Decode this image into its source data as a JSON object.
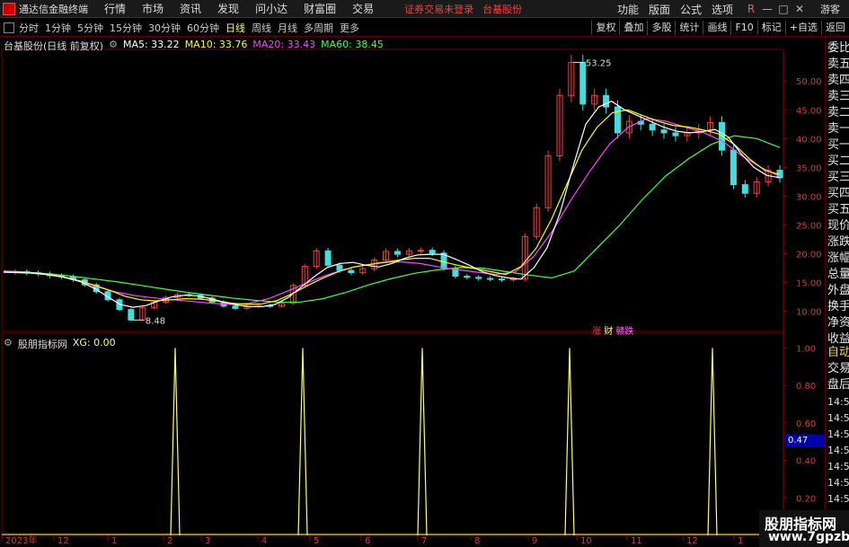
{
  "app": {
    "title": "通达信金融终端",
    "menus": [
      "行情",
      "市场",
      "资讯",
      "发现",
      "问小达",
      "财富圈",
      "交易"
    ],
    "warning": "证券交易未登录",
    "stock_name_top": "台基股份",
    "right_menus": [
      "功能",
      "版面",
      "公式",
      "选项"
    ],
    "guest": "游客",
    "window_buttons": [
      "R",
      "—",
      "□",
      "✕"
    ]
  },
  "toolbar": {
    "periods": [
      "分时",
      "1分钟",
      "5分钟",
      "15分钟",
      "30分钟",
      "60分钟",
      "日线",
      "周线",
      "月线",
      "多周期",
      "更多"
    ],
    "active_period": "日线",
    "buttons": [
      "复权",
      "叠加",
      "多股",
      "统计",
      "画线",
      "F10",
      "标记",
      "+自选",
      "返回"
    ]
  },
  "main_chart": {
    "legend_title": "台基股份(日线 前复权)",
    "ma": [
      {
        "label": "MA5: 33.22",
        "color": "#ffffff"
      },
      {
        "label": "MA10: 33.76",
        "color": "#ffff00"
      },
      {
        "label": "MA20: 33.43",
        "color": "#ff44ff"
      },
      {
        "label": "MA60: 38.45",
        "color": "#44ff44"
      }
    ],
    "annotations": {
      "high": "53.25",
      "low": "8.48"
    },
    "badges": {
      "zhang": "涨",
      "cai": "财",
      "dian": "赣跌"
    }
  },
  "sub_chart": {
    "legend_title": "股朋指标网",
    "xg_label": "XG: 0.00",
    "xg_axis_value": "0.47"
  },
  "side_panel": {
    "items_top": [
      "委比",
      "卖五",
      "卖四",
      "卖三",
      "卖二",
      "卖一",
      "买一",
      "买二",
      "买三",
      "买四",
      "买五",
      "现价",
      "涨跌",
      "涨幅",
      "总量",
      "外盘",
      "换手",
      "净资",
      "收益"
    ],
    "items_bottom": [
      "自动",
      "交易",
      "盘后"
    ],
    "times": [
      "14:56",
      "14:56",
      "14:56",
      "14:56",
      "14:56",
      "14:56",
      "14:56"
    ]
  },
  "watermark": {
    "line1": "股朋指标网",
    "line2": "www.7gpzb.com"
  },
  "chart_data": [
    {
      "type": "line",
      "name": "daily-candles",
      "y_axis_labels": [
        "50.00",
        "45.00",
        "40.00",
        "35.00",
        "30.00",
        "25.00",
        "20.00",
        "15.00",
        "10.00"
      ],
      "ylim": [
        6.5,
        55.5
      ],
      "x_labels": [
        "2023年",
        "12",
        "1",
        "2",
        "3",
        "4",
        "5",
        "6",
        "7",
        "8",
        "9",
        "10",
        "11",
        "12",
        "1"
      ],
      "price_path": [
        16.8,
        16.9,
        16.7,
        16.5,
        16.2,
        16.0,
        15.5,
        14.6,
        13.4,
        12.0,
        10.3,
        8.48,
        10.6,
        11.6,
        12.4,
        12.9,
        12.8,
        12.3,
        11.6,
        10.9,
        10.5,
        10.8,
        11.0,
        10.9,
        11.4,
        14.5,
        17.8,
        20.5,
        18.0,
        17.1,
        16.7,
        17.4,
        18.9,
        20.4,
        19.9,
        20.5,
        20.6,
        20.1,
        17.5,
        16.1,
        15.9,
        15.7,
        15.6,
        15.5,
        15.6,
        23.0,
        28.0,
        37.0,
        47.5,
        53.25,
        46.0,
        47.5,
        45.5,
        41.0,
        43.0,
        42.5,
        41.5,
        41.0,
        40.5,
        41.0,
        41.5,
        42.8,
        38.0,
        32.0,
        30.5,
        32.5,
        34.5,
        33.2
      ],
      "ma5": [
        16.8,
        16.8,
        16.7,
        16.5,
        16.2,
        15.8,
        15.1,
        14.0,
        12.6,
        11.2,
        10.7,
        11.0,
        11.8,
        12.5,
        12.8,
        12.7,
        12.2,
        11.6,
        11.1,
        10.8,
        10.8,
        11.2,
        12.4,
        14.2,
        16.0,
        17.6,
        18.3,
        18.5,
        18.0,
        17.7,
        18.3,
        19.2,
        19.8,
        19.9,
        19.9,
        19.0,
        18.0,
        16.9,
        16.2,
        15.8,
        15.6,
        17.6,
        21.0,
        27.0,
        35.0,
        42.5,
        45.5,
        46.5,
        45.0,
        44.0,
        43.0,
        42.0,
        41.3,
        41.0,
        41.2,
        41.6,
        40.3,
        37.4,
        35.0,
        33.6,
        33.22
      ],
      "ma10": [
        16.8,
        16.7,
        16.6,
        16.3,
        15.9,
        15.3,
        14.5,
        13.6,
        12.6,
        12.0,
        11.8,
        12.0,
        12.2,
        12.1,
        11.8,
        11.4,
        11.2,
        11.3,
        11.9,
        13.1,
        14.5,
        15.8,
        16.9,
        17.7,
        18.1,
        18.5,
        18.9,
        19.2,
        19.2,
        18.5,
        17.9,
        17.4,
        16.9,
        16.4,
        17.8,
        21.0,
        26.0,
        32.0,
        38.0,
        42.0,
        44.5,
        45.0,
        44.0,
        43.0,
        42.3,
        42.0,
        41.5,
        40.8,
        39.0,
        36.5,
        34.5,
        33.76
      ],
      "ma20": [
        16.9,
        16.8,
        16.5,
        16.0,
        15.2,
        14.2,
        13.3,
        12.7,
        12.3,
        12.0,
        11.7,
        11.4,
        11.2,
        11.4,
        12.2,
        13.5,
        14.9,
        16.2,
        17.3,
        18.0,
        18.5,
        18.6,
        18.3,
        17.7,
        17.2,
        16.8,
        16.4,
        16.8,
        19.5,
        24.0,
        29.5,
        34.5,
        39.0,
        42.0,
        43.5,
        43.0,
        42.0,
        41.0,
        39.5,
        37.0,
        35.0,
        33.43
      ],
      "ma60": [
        17.0,
        16.8,
        16.5,
        16.1,
        15.6,
        15.1,
        14.5,
        13.9,
        13.3,
        12.8,
        12.3,
        11.9,
        11.6,
        11.6,
        12.2,
        13.3,
        14.6,
        15.7,
        16.6,
        17.2,
        17.6,
        17.5,
        16.9,
        16.3,
        15.8,
        17.0,
        21.0,
        25.0,
        29.5,
        33.5,
        36.5,
        39.0,
        40.5,
        40.0,
        38.45
      ]
    },
    {
      "type": "line",
      "name": "XG",
      "y_axis_labels": [
        "1.00",
        "0.80",
        "0.60",
        "0.40",
        "0.20"
      ],
      "ylim": [
        0,
        1.05
      ],
      "signal_spikes": [
        {
          "x": "2023-02",
          "value": 1
        },
        {
          "x": "2023-05",
          "value": 1
        },
        {
          "x": "2023-07",
          "value": 1
        },
        {
          "x": "2023-10",
          "value": 1
        },
        {
          "x": "2023-12",
          "value": 1
        }
      ]
    }
  ]
}
